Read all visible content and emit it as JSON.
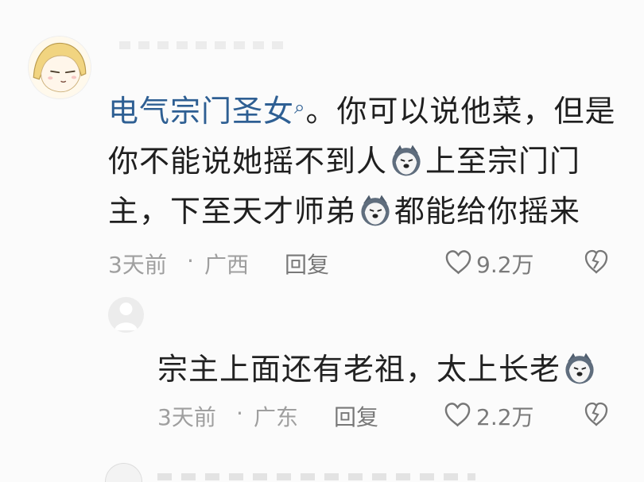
{
  "comment": {
    "username": "电气宗门圣女",
    "text_line1_after_name": "。你可以说他菜，但是",
    "text_line2_a": "你不能说她摇不到人",
    "text_line2_b": "上至宗门门",
    "text_line3_a": "主，下至天才师弟",
    "text_line3_b": "都能给你摇来",
    "time": "3天前",
    "location": "广西",
    "reply_label": "回复",
    "likes": "9.2万"
  },
  "reply": {
    "text": "宗主上面还有老祖，太上长老",
    "time": "3天前",
    "location": "广东",
    "reply_label": "回复",
    "likes": "2.2万"
  },
  "icons": {
    "dog_emoji": "husky-emoji-icon",
    "heart": "heart-outline-icon",
    "dislike": "broken-heart-icon",
    "search_hint": "search-icon"
  },
  "colors": {
    "username": "#2e5f93",
    "meta": "#9f9f9f"
  }
}
